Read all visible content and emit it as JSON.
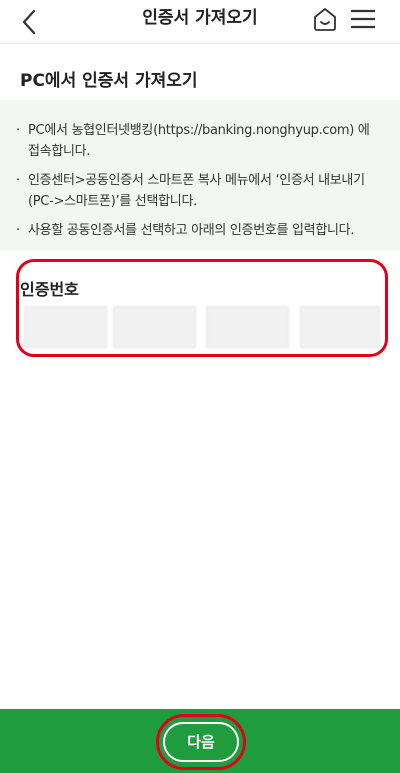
{
  "header": {
    "title": "인증서 가져오기",
    "back_icon": "chevron-left-icon",
    "home_icon": "home-icon",
    "menu_icon": "hamburger-menu-icon"
  },
  "section": {
    "title": "PC에서 인증서 가져오기"
  },
  "instructions": [
    {
      "bullet": "·",
      "text": "PC에서 농협인터넷뱅킹(https://banking.nonghyup.com) 에 접속합니다."
    },
    {
      "bullet": "·",
      "text": "인증센터>공동인증서 스마트폰 복사 메뉴에서 ‘인증서 내보내기(PC->스마트폰)’를 선택합니다."
    },
    {
      "bullet": "·",
      "text": "사용할 공동인증서를 선택하고 아래의 인증번호를 입력합니다."
    }
  ],
  "auth": {
    "label": "인증번호",
    "fields": [
      "",
      "",
      "",
      ""
    ]
  },
  "footer": {
    "next_label": "다음"
  },
  "colors": {
    "brand_green": "#1f9d3e",
    "highlight_red": "#e0001b",
    "info_bg": "#f2f7f1"
  }
}
